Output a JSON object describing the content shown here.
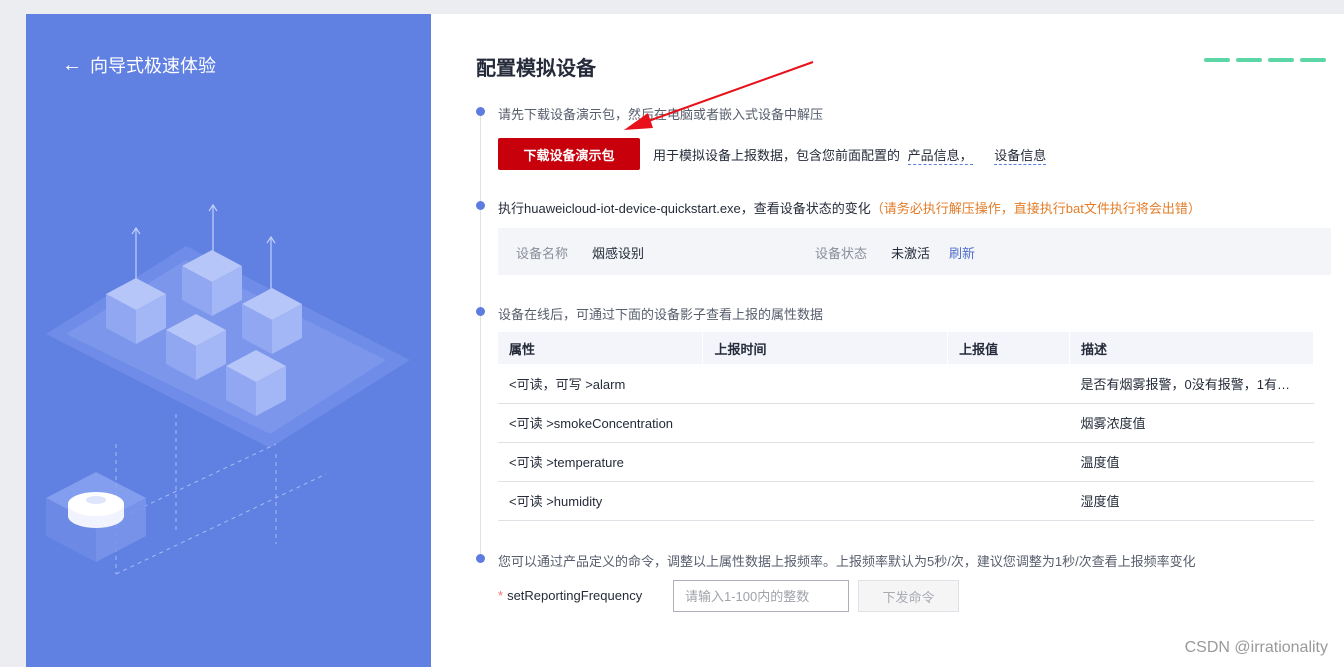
{
  "left": {
    "back_label": "向导式极速体验"
  },
  "main": {
    "title": "配置模拟设备",
    "steps": {
      "step1": "请先下载设备演示包，然后在电脑或者嵌入式设备中解压",
      "step2_main": "执行huaweicloud-iot-device-quickstart.exe，查看设备状态的变化",
      "step2_warn": "（请务必执行解压操作，直接执行bat文件执行将会出错）",
      "step3": "设备在线后，可通过下面的设备影子查看上报的属性数据",
      "step4": "您可以通过产品定义的命令，调整以上属性数据上报频率。上报频率默认为5秒/次，建议您调整为1秒/次查看上报频率变化"
    },
    "download": {
      "button": "下载设备演示包",
      "desc": "用于模拟设备上报数据，包含您前面配置的",
      "link1": "产品信息，",
      "link2": "设备信息"
    },
    "status": {
      "name_label": "设备名称",
      "name_value": "烟感设别",
      "state_label": "设备状态",
      "state_value": "未激活",
      "refresh": "刷新"
    },
    "table": {
      "headers": [
        "属性",
        "上报时间",
        "上报值",
        "描述"
      ],
      "rows": [
        {
          "prop": "<可读，可写 >alarm",
          "time": "",
          "value": "",
          "desc": "是否有烟雾报警，0没有报警，1有…"
        },
        {
          "prop": "<可读 >smokeConcentration",
          "time": "",
          "value": "",
          "desc": "烟雾浓度值"
        },
        {
          "prop": "<可读 >temperature",
          "time": "",
          "value": "",
          "desc": "温度值"
        },
        {
          "prop": "<可读 >humidity",
          "time": "",
          "value": "",
          "desc": "湿度值"
        }
      ]
    },
    "command": {
      "required_mark": "*",
      "label": "setReportingFrequency",
      "placeholder": "请输入1-100内的整数",
      "send": "下发命令"
    }
  },
  "watermark": "CSDN @irrationality",
  "colors": {
    "accent": "#5e7ce0",
    "primary_button": "#c7000b",
    "warning": "#e37d29",
    "progress": "#5dd6a6",
    "left_panel": "#6080e2"
  }
}
